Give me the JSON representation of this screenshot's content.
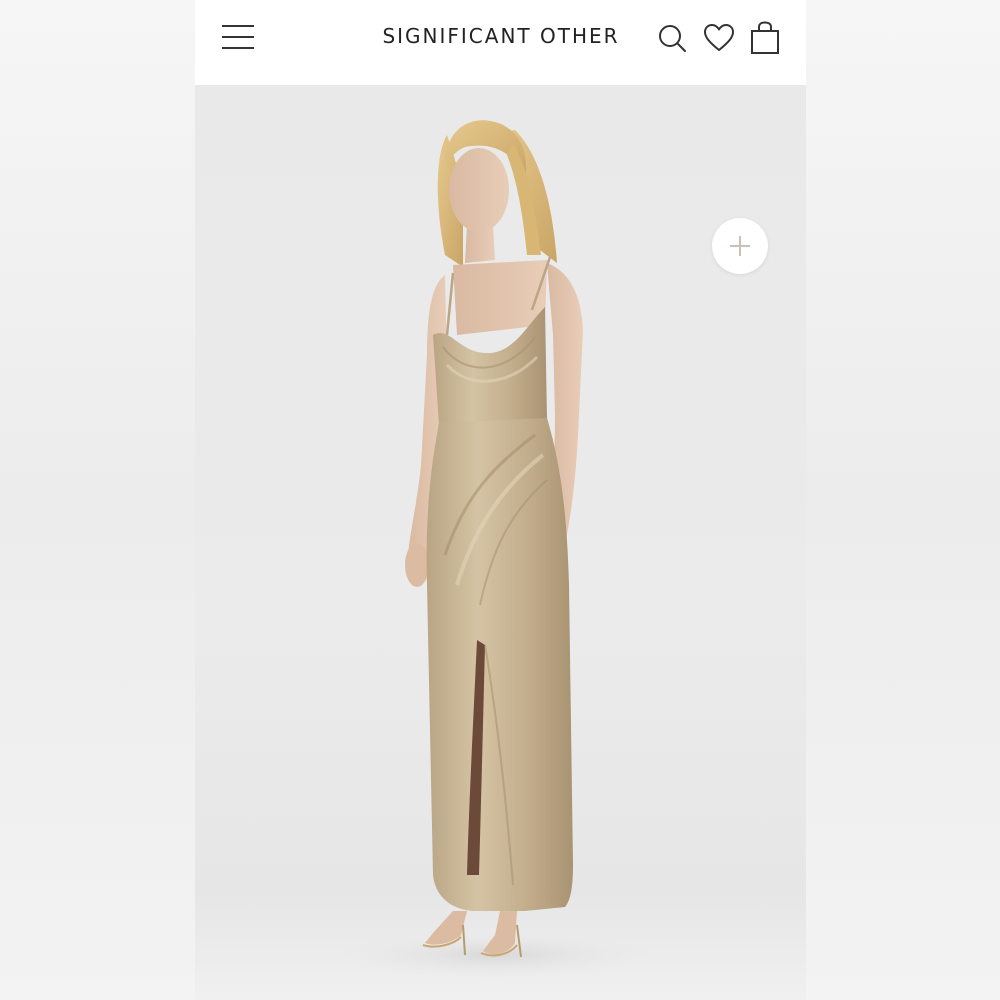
{
  "header": {
    "brand": "SIGNIFICANT OTHER",
    "icons": {
      "menu": "hamburger-menu-icon",
      "search": "search-icon",
      "wishlist": "heart-icon",
      "bag": "shopping-bag-icon"
    }
  },
  "product": {
    "zoom_icon": "plus-icon"
  },
  "colors": {
    "header_bg": "#ffffff",
    "brand_text": "#222222",
    "backdrop": "#ebebeb",
    "dress": "#c7b394"
  }
}
